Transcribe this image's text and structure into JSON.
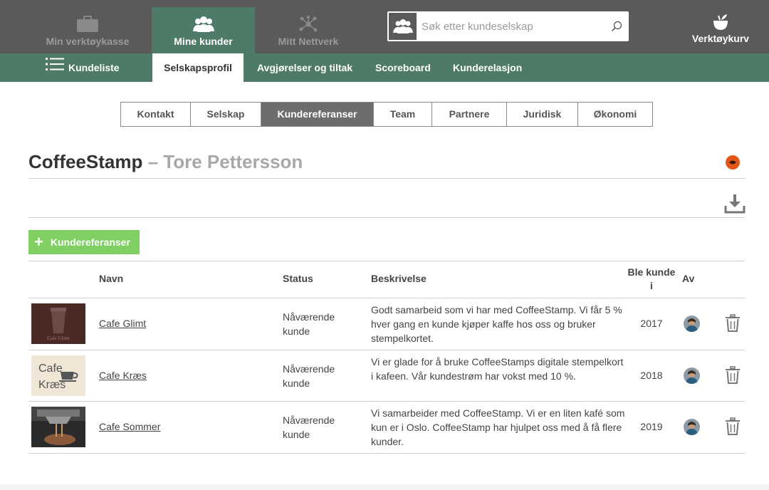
{
  "topnav": {
    "toolbox_label": "Min verktøykasse",
    "customers_label": "Mine kunder",
    "network_label": "Mitt Nettverk",
    "search_placeholder": "Søk etter kundeselskap",
    "basket_label": "Verktøykurv"
  },
  "subnav": {
    "list_label": "Kundeliste",
    "profile_label": "Selskapsprofil",
    "decisions_label": "Avgjørelser og tiltak",
    "scoreboard_label": "Scoreboard",
    "relation_label": "Kunderelasjon"
  },
  "tabs": [
    "Kontakt",
    "Selskap",
    "Kundereferanser",
    "Team",
    "Partnere",
    "Juridisk",
    "Økonomi"
  ],
  "header": {
    "company": "CoffeeStamp",
    "separator": "–",
    "person": "Tore Pettersson"
  },
  "add_button_label": "Kundereferanser",
  "table": {
    "columns": {
      "name": "Navn",
      "status": "Status",
      "description": "Beskrivelse",
      "year": "Ble kunde i",
      "by": "Av"
    },
    "rows": [
      {
        "name": "Cafe Glimt",
        "thumb_text": "Cafe Glimt",
        "status": "Nåværende kunde",
        "description": "Godt samarbeid som vi har med CoffeeStamp. Vi får 5 % hver gang en kunde kjøper kaffe hos oss og bruker stempelkortet.",
        "year": "2017"
      },
      {
        "name": "Cafe Kræs",
        "thumb_text_1": "Cafe",
        "thumb_text_2": "Kræs",
        "status": "Nåværende kunde",
        "description": "Vi er glade for å bruke CoffeeStamps digitale stempelkort i kafeen. Vår kundestrøm har vokst med 10 %.",
        "year": "2018"
      },
      {
        "name": "Cafe Sommer",
        "status": "Nåværende kunde",
        "description": "Vi samarbeider med CoffeeStamp. Vi er en liten kafé som kun er i Oslo. CoffeeStamp har hjulpet oss med å få flere kunder.",
        "year": "2019"
      }
    ]
  },
  "colors": {
    "topbar": "#5a5a5a",
    "green": "#4e7a68",
    "add_button": "#7fcf63",
    "status_dot": "#e2561a",
    "active_tab": "#6d6d6d"
  },
  "icons": {
    "toolbox": "briefcase-icon",
    "customers": "people-icon",
    "network": "network-icon",
    "search": "magnifier-icon",
    "basket": "basket-icon",
    "list": "hamburger-icon",
    "download": "download-icon",
    "delete": "trash-icon",
    "avatar": "user-avatar-icon"
  }
}
